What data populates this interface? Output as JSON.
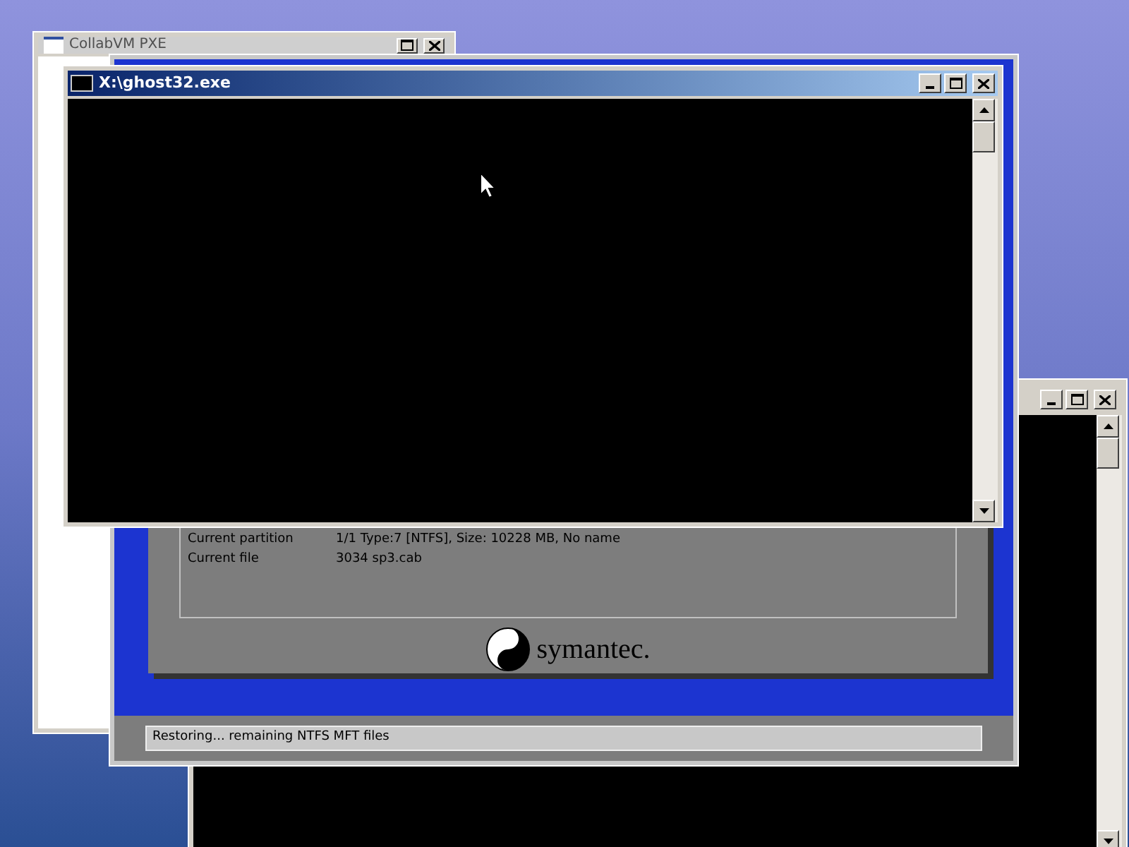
{
  "pxe_window": {
    "title": "CollabVM PXE"
  },
  "console_window": {
    "title": "X:\\ghost32.exe"
  },
  "ghost": {
    "details": [
      {
        "label": "Current partition",
        "value": "1/1 Type:7 [NTFS], Size: 10228 MB, No name"
      },
      {
        "label": "Current file",
        "value": "3034 sp3.cab"
      }
    ],
    "logo": "symantec.",
    "status": "Restoring... remaining NTFS MFT files"
  }
}
